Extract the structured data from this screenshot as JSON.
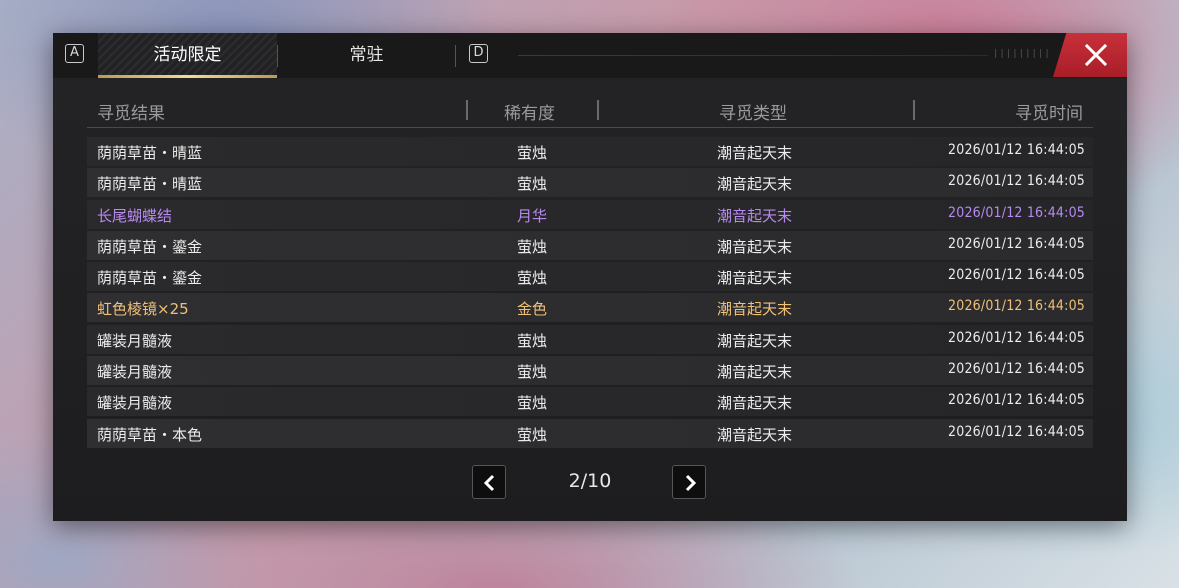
{
  "tabs": {
    "left_key": "A",
    "right_key": "D",
    "items": [
      {
        "label": "活动限定",
        "active": true
      },
      {
        "label": "常驻",
        "active": false
      }
    ]
  },
  "header_deco": "|||||||||",
  "close_icon": "close-icon",
  "columns": {
    "result": "寻觅结果",
    "rarity": "稀有度",
    "type": "寻觅类型",
    "time": "寻觅时间"
  },
  "rows": [
    {
      "name": "荫荫草苗・晴蓝",
      "rarity": "萤烛",
      "type": "潮音起天末",
      "time": "2026/01/12 16:44:05",
      "tier": "normal"
    },
    {
      "name": "荫荫草苗・晴蓝",
      "rarity": "萤烛",
      "type": "潮音起天末",
      "time": "2026/01/12 16:44:05",
      "tier": "normal"
    },
    {
      "name": "长尾蝴蝶结",
      "rarity": "月华",
      "type": "潮音起天末",
      "time": "2026/01/12 16:44:05",
      "tier": "purple"
    },
    {
      "name": "荫荫草苗・鎏金",
      "rarity": "萤烛",
      "type": "潮音起天末",
      "time": "2026/01/12 16:44:05",
      "tier": "normal"
    },
    {
      "name": "荫荫草苗・鎏金",
      "rarity": "萤烛",
      "type": "潮音起天末",
      "time": "2026/01/12 16:44:05",
      "tier": "normal"
    },
    {
      "name": "虹色棱镜×25",
      "rarity": "金色",
      "type": "潮音起天末",
      "time": "2026/01/12 16:44:05",
      "tier": "gold"
    },
    {
      "name": "罐装月髓液",
      "rarity": "萤烛",
      "type": "潮音起天末",
      "time": "2026/01/12 16:44:05",
      "tier": "normal"
    },
    {
      "name": "罐装月髓液",
      "rarity": "萤烛",
      "type": "潮音起天末",
      "time": "2026/01/12 16:44:05",
      "tier": "normal"
    },
    {
      "name": "罐装月髓液",
      "rarity": "萤烛",
      "type": "潮音起天末",
      "time": "2026/01/12 16:44:05",
      "tier": "normal"
    },
    {
      "name": "荫荫草苗・本色",
      "rarity": "萤烛",
      "type": "潮音起天末",
      "time": "2026/01/12 16:44:05",
      "tier": "normal"
    }
  ],
  "pager": {
    "page": "2/10",
    "prev_icon": "chevron-left-icon",
    "next_icon": "chevron-right-icon"
  },
  "colors": {
    "purple": "#b889f0",
    "gold": "#f0c078",
    "close": "#c8303a"
  }
}
